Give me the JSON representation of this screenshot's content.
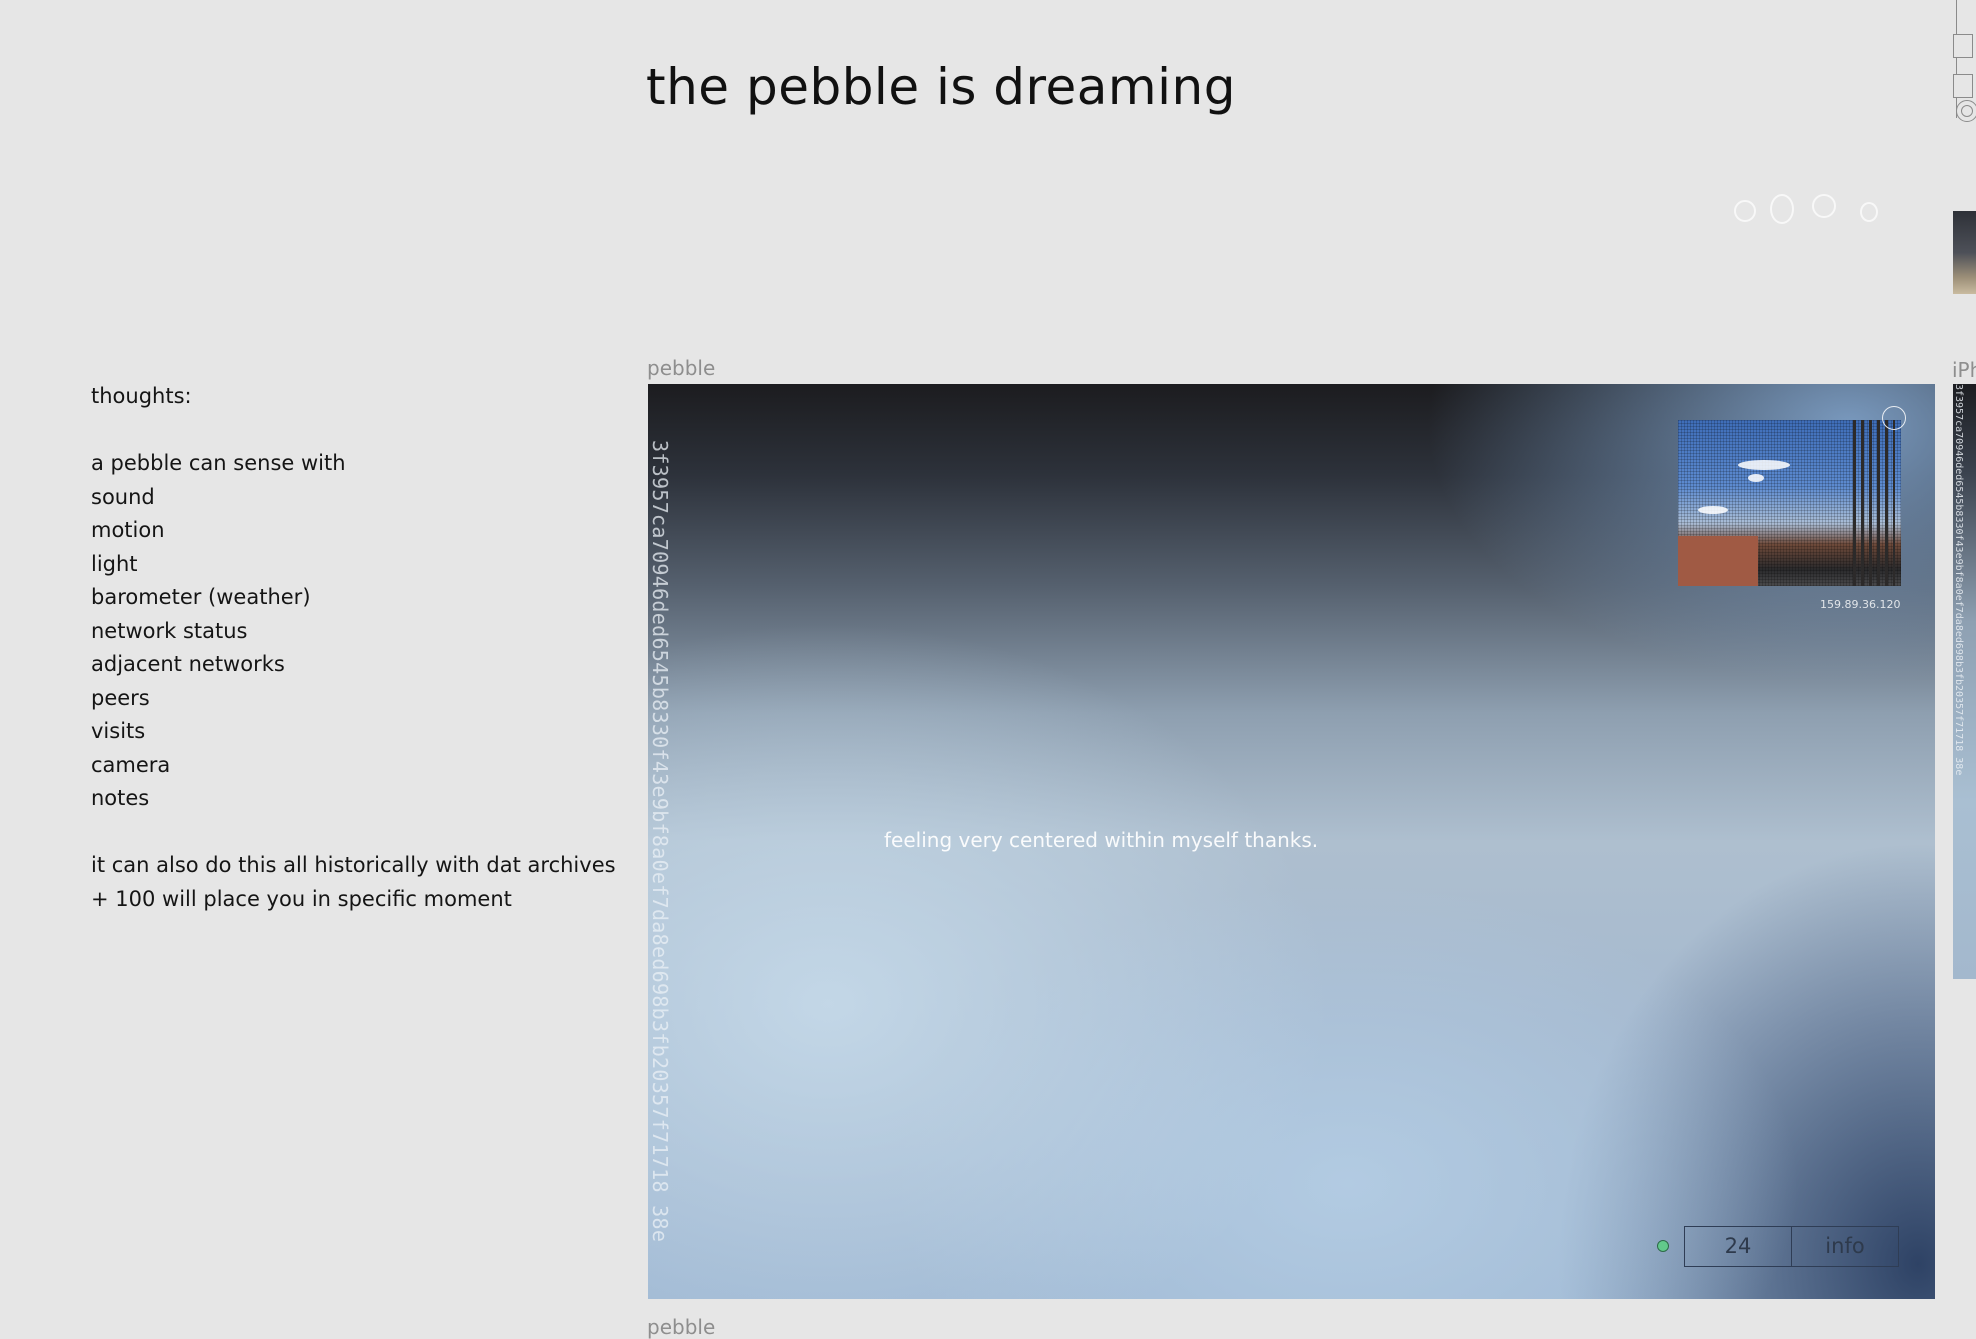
{
  "page": {
    "title": "the pebble is dreaming"
  },
  "thoughts": {
    "heading": "thoughts:",
    "intro": "a pebble can sense with",
    "senses": [
      "sound",
      "motion",
      "light",
      "barometer (weather)",
      "network status",
      "adjacent networks",
      "peers",
      "visits",
      "camera",
      "notes"
    ],
    "footer_lines": [
      "it can also do this all historically with dat archives",
      "+ 100 will place you in specific moment"
    ]
  },
  "main_frame": {
    "label": "pebble",
    "hash": "3f3957ca70946ded6545b8330f43e9bf8a0ef7da8ed698b3fb20357f71718 38e",
    "message": "feeling very centered within myself thanks.",
    "camera": {
      "ip": "159.89.36.120",
      "close_icon": "circle-close-icon"
    },
    "status": {
      "color": "#62c98b",
      "state": "online"
    },
    "controls": {
      "count": "24",
      "info_label": "info"
    }
  },
  "next_frame": {
    "label": "pebble"
  },
  "side_frame": {
    "label": "iPh",
    "hash": "3f3957ca70946ded6545b8330f43e9bf8a0ef7da8ed698b3fb20357f71718 38e"
  },
  "faint_icons": [
    "sound-icon",
    "motion-icon",
    "light-icon",
    "peer-icon"
  ],
  "edge_icons": [
    "window-icon",
    "window-icon",
    "target-icon"
  ]
}
